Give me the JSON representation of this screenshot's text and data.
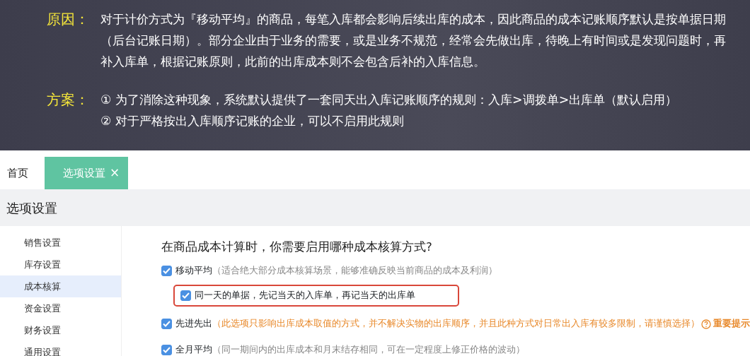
{
  "banner": {
    "sections": [
      {
        "label": "原因：",
        "lines": [
          "对于计价方式为『移动平均』的商品，每笔入库都会影响后续出库的成本，因此商品的成本记账顺序默认是按单据日期（后台记账日期）。部分企业由于业务的需要，或是业务不规范，经常会先做出库，待晚上有时间或是发现问题时，再补入库单，根据记账原则，此前的出库成本则不会包含后补的入库信息。"
        ]
      },
      {
        "label": "方案：",
        "lines": [
          "① 为了消除这种现象，系统默认提供了一套同天出入库记账顺序的规则：入库>调拨单>出库单（默认启用）",
          "② 对于严格按出入库顺序记账的企业，可以不启用此规则"
        ]
      }
    ]
  },
  "tabs": [
    {
      "label": "首页",
      "selected": false
    },
    {
      "label": "选项设置",
      "selected": true,
      "close": "×"
    }
  ],
  "page_title": "选项设置",
  "sidebar": {
    "items": [
      {
        "label": "销售设置",
        "selected": false
      },
      {
        "label": "库存设置",
        "selected": false
      },
      {
        "label": "成本核算",
        "selected": true
      },
      {
        "label": "资金设置",
        "selected": false
      },
      {
        "label": "财务设置",
        "selected": false
      },
      {
        "label": "通用设置",
        "selected": false
      }
    ]
  },
  "question": "在商品成本计算时，你需要启用哪种成本核算方式?",
  "options": [
    {
      "label": "移动平均",
      "note": "（适合绝大部分成本核算场景，能够准确反映当前商品的成本及利润）",
      "kind": "normal",
      "checked": true,
      "children": [
        {
          "label": "同一天的单据，先记当天的入库单，再记当天的出库单",
          "checked": true,
          "highlighted": true
        }
      ]
    },
    {
      "label": "先进先出",
      "note": "（此选项只影响出库成本取值的方式，并不解决实物的出库顺序，并且此种方式对日常出入库有较多限制，请谨慎选择）",
      "kind": "warning",
      "checked": true,
      "hint": "重要提示"
    },
    {
      "label": "全月平均",
      "note": "（同一期间内的出库成本和月末结存相同，可在一定程度上修正价格的波动）",
      "kind": "normal",
      "checked": true
    }
  ]
}
